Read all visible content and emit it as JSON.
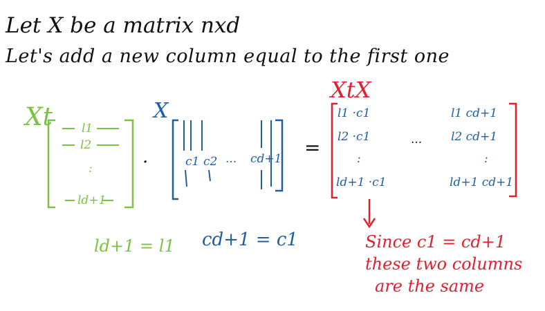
{
  "colors": {
    "ink": "#111111",
    "rows": "#7cc242",
    "cols": "#1f5f9e",
    "note": "#e0202e"
  },
  "intro": {
    "line1": "Let  X  be  a matrix  nxd",
    "line2": "Let's add a new column equal to the first one"
  },
  "xt_label": "Xt",
  "x_label": "X",
  "xtx_label": "XtX",
  "xt_rows": [
    "l1",
    "l2",
    ":",
    "ld+1"
  ],
  "x_cols": [
    "c1",
    "c2",
    "...",
    "cd+1"
  ],
  "dot": "·",
  "equals": "=",
  "product": {
    "left": [
      "l1 ·c1",
      "l2 ·c1",
      ":",
      "ld+1 ·c1"
    ],
    "middle": "...",
    "right": [
      "l1 cd+1",
      "l2 cd+1",
      ":",
      "ld+1 cd+1"
    ]
  },
  "eq_rows": "ld+1 = l1",
  "eq_cols": "cd+1 = c1",
  "note": {
    "line1": "Since c1 = cd+1",
    "line2": "these two columns",
    "line3": "are the same"
  }
}
